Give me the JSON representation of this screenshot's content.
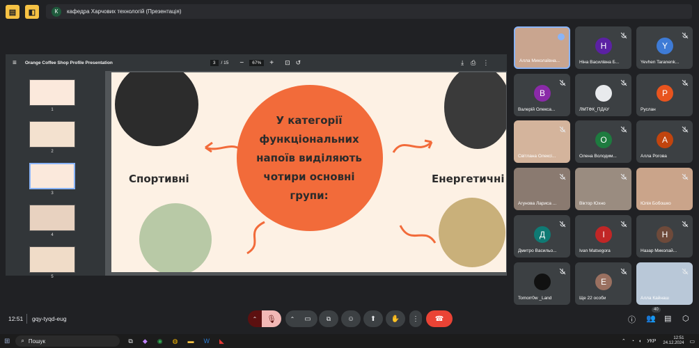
{
  "meeting": {
    "chip_letter": "К",
    "title": "кафедра Харчових технологій (Презентація)",
    "time": "12:51",
    "code": "gqy-tyqd-eug",
    "participant_count": "40"
  },
  "viewer": {
    "doc_title": "Orange Coffee Shop Profile Presentation",
    "page_current": "3",
    "page_total": "/ 15",
    "zoom": "67%",
    "thumb_numbers": [
      "1",
      "2",
      "3",
      "4",
      "5"
    ]
  },
  "slide": {
    "center_text": "У категорії функціональних напоїв виділяють чотири основні групи:",
    "label_left": "Спортивні",
    "label_right": "Енергетичні",
    "colors": {
      "orange": "#f26b3a",
      "bg": "#fdf1e4"
    }
  },
  "participants": [
    {
      "name": "Алла Миколаївна...",
      "initial": "",
      "color": "#c9a58f",
      "photo": true
    },
    {
      "name": "Ніна Василівна Б...",
      "initial": "Н",
      "color": "#5b21a3"
    },
    {
      "name": "Yevhen Taranenk...",
      "initial": "Y",
      "color": "#3e7bd6"
    },
    {
      "name": "Валерій Олекса...",
      "initial": "В",
      "color": "#8a2aa8"
    },
    {
      "name": "ЛМТФК_ПДАУ",
      "initial": "",
      "color": "#e8eaed",
      "logo": true
    },
    {
      "name": "Руслан",
      "initial": "Р",
      "color": "#e8541e"
    },
    {
      "name": "Світлана Олексі...",
      "initial": "",
      "color": "#d4b49c",
      "photo": true
    },
    {
      "name": "Олена Володим...",
      "initial": "О",
      "color": "#1e7b3f"
    },
    {
      "name": "Алла Рогова",
      "initial": "А",
      "color": "#c1440e"
    },
    {
      "name": "Агунова Лариса ...",
      "initial": "",
      "color": "#8a7a70",
      "photo": true
    },
    {
      "name": "Віктор Юхно",
      "initial": "",
      "color": "#9a8c80",
      "photo": true
    },
    {
      "name": "Юлія Бобошко",
      "initial": "",
      "color": "#caa48a",
      "photo": true
    },
    {
      "name": "Дмитро Васильо...",
      "initial": "Д",
      "color": "#0f7a74"
    },
    {
      "name": "Ivan Matsegora",
      "initial": "I",
      "color": "#c12626"
    },
    {
      "name": "Назар Миколай...",
      "initial": "Н",
      "color": "#6e4a3a"
    },
    {
      "name": "Tomorr0w _Land",
      "initial": "",
      "color": "#111111",
      "logo": true
    },
    {
      "name": "Ще 22 особи",
      "initial": "Е",
      "color": "#9a7060"
    },
    {
      "name": "Алла Кайнаш",
      "initial": "",
      "color": "#b9c8d8",
      "photo": true
    }
  ],
  "taskbar": {
    "search_placeholder": "Пошук",
    "lang": "УКР",
    "clock_time": "12:51",
    "clock_date": "24.12.2024"
  }
}
